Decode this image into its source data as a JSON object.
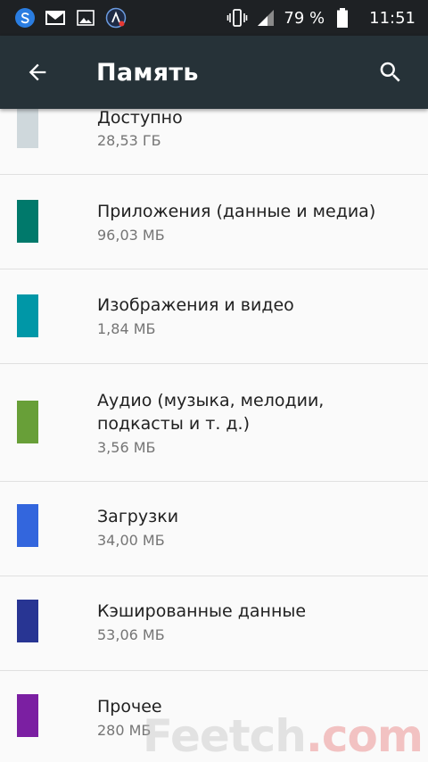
{
  "status_bar": {
    "battery_percent": "79 %",
    "time": "11:51",
    "icons": [
      "s-app-icon",
      "gmail-icon",
      "gallery-icon",
      "nav-app-icon",
      "vibrate-icon",
      "signal-icon",
      "battery-icon"
    ]
  },
  "app_bar": {
    "title": "Память",
    "icons": [
      "arrow-back-icon",
      "search-icon"
    ]
  },
  "items": [
    {
      "name": "Доступно",
      "size": "28,53 ГБ",
      "color": "#cfd8dc"
    },
    {
      "name": "Приложения (данные и медиа)",
      "size": "96,03 МБ",
      "color": "#00796b"
    },
    {
      "name": "Изображения и видео",
      "size": "1,84 МБ",
      "color": "#0097a7"
    },
    {
      "name": "Аудио (музыка, мелодии, подкасты и т. д.)",
      "size": "3,56 МБ",
      "color": "#689f38"
    },
    {
      "name": "Загрузки",
      "size": "34,00 МБ",
      "color": "#3366dd"
    },
    {
      "name": "Кэшированные данные",
      "size": "53,06 МБ",
      "color": "#283593"
    },
    {
      "name": "Прочее",
      "size": "280 МБ",
      "color": "#7b1fa2"
    }
  ],
  "watermark": {
    "text": "Feetch",
    "suffix": ".com"
  }
}
